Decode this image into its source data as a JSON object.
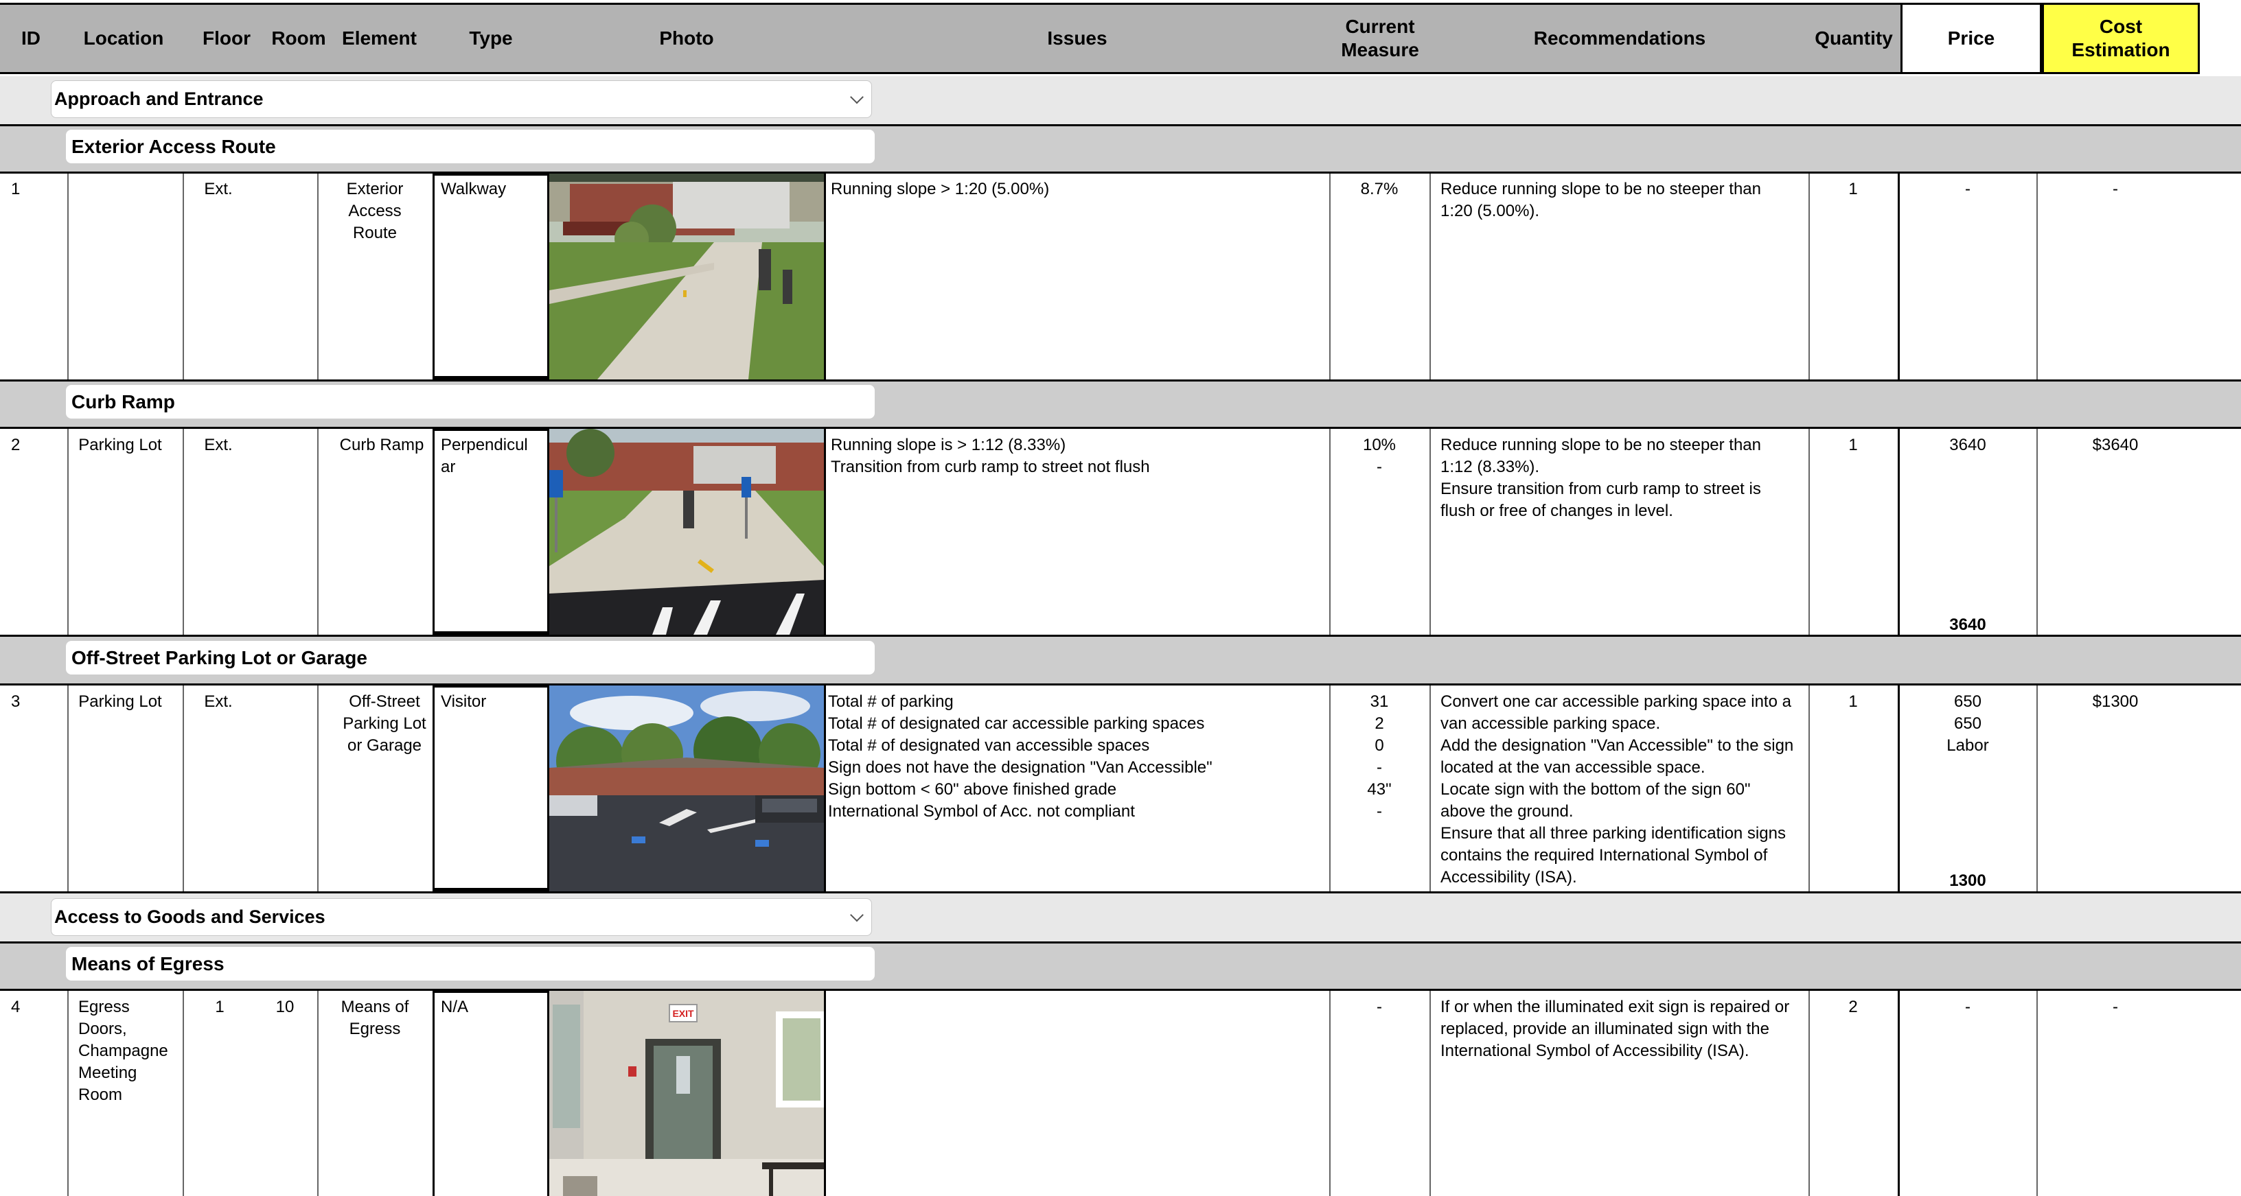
{
  "headers": {
    "id": "ID",
    "location": "Location",
    "floor": "Floor",
    "room": "Room",
    "element": "Element",
    "type": "Type",
    "photo": "Photo",
    "issues": "Issues",
    "current_measure": "Current\nMeasure",
    "recommendations": "Recommendations",
    "quantity": "Quantity",
    "price": "Price",
    "cost_estimation": "Cost\nEstimation"
  },
  "colors": {
    "header_bg": "#b3b3b3",
    "cost_header_bg": "#ffff47",
    "section_bg": "#e8e8e8",
    "subsection_bg": "#cdcdcd"
  },
  "sections": [
    {
      "title": "Approach and Entrance",
      "icon": "chevron-down-icon",
      "subsections": [
        {
          "title": "Exterior Access Route",
          "rows": [
            {
              "id": "1",
              "location": "",
              "floor": "Ext.",
              "room": "",
              "element": "Exterior\nAccess\nRoute",
              "type": "Walkway",
              "issues": "Running slope > 1:20 (5.00%)",
              "measure": "8.7%",
              "recommendations": "Reduce running slope to be no steeper than\n1:20 (5.00%).",
              "quantity": "1",
              "price": "-",
              "price_total": "",
              "cost": "-"
            }
          ]
        },
        {
          "title": "Curb Ramp",
          "rows": [
            {
              "id": "2",
              "location": "Parking Lot",
              "floor": "Ext.",
              "room": "",
              "element": "Curb Ramp",
              "type": "Perpendicul\nar",
              "issues": "Running slope is > 1:12 (8.33%)\nTransition from curb ramp to street not flush",
              "measure": "10%\n-",
              "recommendations": "Reduce running slope to be no steeper than\n1:12 (8.33%).\nEnsure transition from curb ramp to street is\nflush or free of changes in level.",
              "quantity": "1",
              "price": "3640",
              "price_total": "3640",
              "cost": "$3640"
            }
          ]
        },
        {
          "title": "Off-Street Parking Lot or Garage",
          "rows": [
            {
              "id": "3",
              "location": "Parking Lot",
              "floor": "Ext.",
              "room": "",
              "element": "Off-Street\nParking Lot\nor Garage",
              "type": "Visitor",
              "issues": "Total # of parking\nTotal # of designated car accessible parking spaces\nTotal # of designated van accessible spaces\nSign does not have the designation \"Van Accessible\"\nSign bottom < 60\" above finished grade\nInternational Symbol of Acc. not compliant",
              "measure": "31\n2\n0\n-\n43\"\n-",
              "recommendations": "Convert one car accessible parking space into a\nvan accessible parking space.\nAdd the designation \"Van Accessible\" to the sign\nlocated at the van accessible space.\nLocate sign with the bottom of the sign 60\"\nabove the ground.\nEnsure that all three parking identification signs\ncontains the required International Symbol of\nAccessibility (ISA).",
              "quantity": "1",
              "price": "650\n650\nLabor",
              "price_total": "1300",
              "cost": "$1300"
            }
          ]
        }
      ]
    },
    {
      "title": "Access to Goods and Services",
      "icon": "chevron-down-icon",
      "subsections": [
        {
          "title": "Means of Egress",
          "rows": [
            {
              "id": "4",
              "location": "Egress\nDoors,\nChampagne\nMeeting\nRoom",
              "floor": "1",
              "room": "10",
              "element": "Means of\nEgress",
              "type": "N/A",
              "issues": "",
              "measure": "-",
              "recommendations": "If or when the illuminated exit sign is repaired or\nreplaced, provide an illuminated sign with the\nInternational Symbol of Accessibility (ISA).",
              "quantity": "2",
              "price": "-",
              "price_total": "",
              "cost": "-"
            }
          ]
        }
      ]
    }
  ],
  "photos": {
    "row1": "walkway-photo",
    "row2": "curb-ramp-photo",
    "row3": "parking-lot-photo",
    "row4": "exit-door-photo",
    "exit_sign_text": "EXIT"
  }
}
